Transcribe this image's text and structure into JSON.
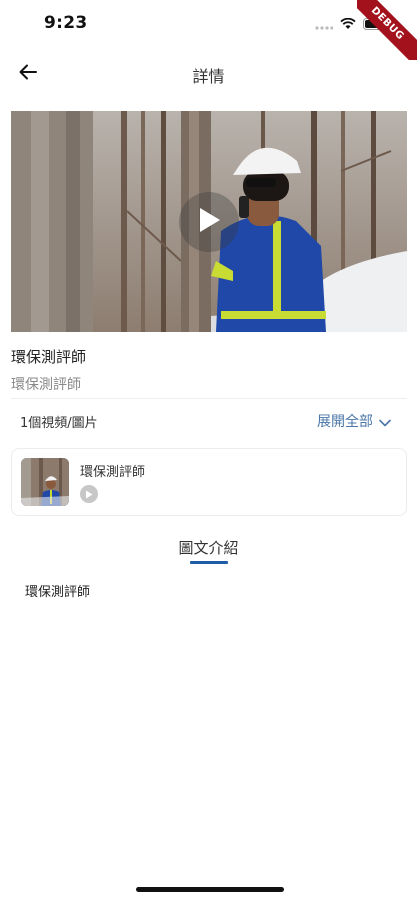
{
  "status_bar": {
    "time": "9:23",
    "debug_banner": "DEBUG"
  },
  "header": {
    "title": "詳情",
    "back_icon": "arrow-left-icon"
  },
  "video": {
    "play_icon": "play-icon"
  },
  "info": {
    "title": "環保測評師",
    "subtitle": "環保測評師"
  },
  "media_list": {
    "count_label": "1個視頻/圖片",
    "expand_label": "展開全部",
    "items": [
      {
        "title": "環保測評師",
        "type_icon": "play-circle-icon"
      }
    ]
  },
  "tabs": {
    "active_label": "圖文介紹",
    "accent_color": "#1f5ca8"
  },
  "content": {
    "description": "環保測評師"
  }
}
